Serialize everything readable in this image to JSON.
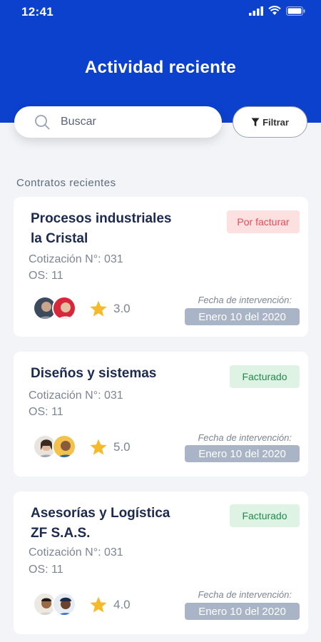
{
  "status_bar": {
    "time": "12:41"
  },
  "header": {
    "title": "Actividad reciente"
  },
  "search": {
    "placeholder": "Buscar"
  },
  "filter": {
    "label": "Filtrar"
  },
  "section": {
    "title": "Contratos recientes"
  },
  "contracts": [
    {
      "title_line1": "Procesos industriales",
      "title_line2": "la Cristal",
      "quote": "Cotización N°: 031",
      "os": "OS: 11",
      "status": "Por facturar",
      "rating": "3.0",
      "date_label": "Fecha de intervención:",
      "date": "Enero 10 del 2020"
    },
    {
      "title_line1": "Diseños y sistemas",
      "title_line2": "",
      "quote": "Cotización N°: 031",
      "os": "OS: 11",
      "status": "Facturado",
      "rating": "5.0",
      "date_label": "Fecha de intervención:",
      "date": "Enero 10 del 2020"
    },
    {
      "title_line1": "Asesorías y Logística",
      "title_line2": "ZF S.A.S.",
      "quote": "Cotización N°: 031",
      "os": "OS: 11",
      "status": "Facturado",
      "rating": "4.0",
      "date_label": "Fecha de intervención:",
      "date": "Enero 10 del 2020"
    }
  ],
  "icons": {
    "signal": "signal-icon",
    "wifi": "wifi-icon",
    "battery": "battery-icon",
    "search": "search-icon",
    "filter": "filter-icon",
    "star": "star-icon"
  },
  "colors": {
    "brand": "#0b41cc",
    "pending_bg": "#fde0e0",
    "pending_text": "#e24d5b",
    "done_bg": "#dff3e5",
    "done_text": "#1f8a4c",
    "star": "#f5b92a",
    "date_chip": "#a9b4c6"
  }
}
